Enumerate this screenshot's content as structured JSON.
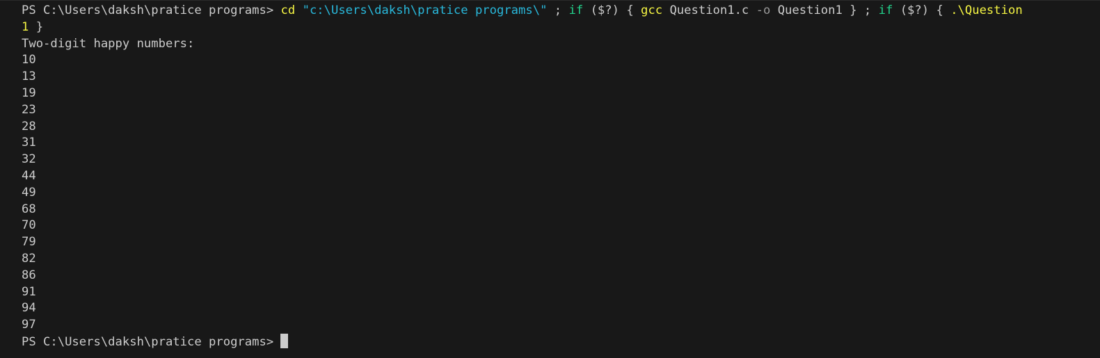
{
  "terminal": {
    "prompt": "PS C:\\Users\\daksh\\pratice programs>",
    "command": {
      "cd": "cd",
      "path": "\"c:\\Users\\daksh\\pratice programs\\\"",
      "sep1": ";",
      "if1": "if",
      "cond1": "($?)",
      "open1": "{",
      "gcc": "gcc",
      "source": "Question1.c",
      "flag": "-o",
      "output": "Question1",
      "close1": "}",
      "sep2": ";",
      "if2": "if",
      "cond2": "($?)",
      "open2": "{",
      "run_part1": ".\\Question",
      "run_part2": "1",
      "close2": "}"
    },
    "output_header": "Two-digit happy numbers:",
    "happy_numbers": [
      "10",
      "13",
      "19",
      "23",
      "28",
      "31",
      "32",
      "44",
      "49",
      "68",
      "70",
      "79",
      "82",
      "86",
      "91",
      "94",
      "97"
    ],
    "final_prompt": "PS C:\\Users\\daksh\\pratice programs>"
  },
  "colors": {
    "background": "#181818",
    "default_text": "#cccccc",
    "command_yellow": "#f5f543",
    "string_cyan": "#29b8db",
    "keyword_green": "#23d18b",
    "parameter_gray": "#9a9a9a"
  }
}
